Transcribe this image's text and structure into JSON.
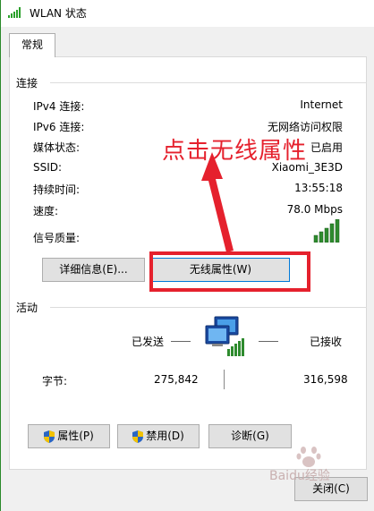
{
  "window": {
    "title": "WLAN 状态"
  },
  "tabs": [
    {
      "label": "常规"
    }
  ],
  "connection": {
    "group_label": "连接",
    "rows": [
      {
        "label": "IPv4 连接:",
        "value": "Internet"
      },
      {
        "label": "IPv6 连接:",
        "value": "无网络访问权限"
      },
      {
        "label": "媒体状态:",
        "value": "已启用"
      },
      {
        "label": "SSID:",
        "value": "Xiaomi_3E3D"
      },
      {
        "label": "持续时间:",
        "value": "13:55:18"
      },
      {
        "label": "速度:",
        "value": "78.0 Mbps"
      }
    ],
    "signal_label": "信号质量:",
    "signal_bars": 5,
    "details_button": "详细信息(E)...",
    "wireless_props_button": "无线属性(W)"
  },
  "activity": {
    "group_label": "活动",
    "sent_label": "已发送",
    "received_label": "已接收",
    "bytes_label": "字节:",
    "bytes_sent": "275,842",
    "bytes_received": "316,598"
  },
  "actions": {
    "properties_button": "属性(P)",
    "disable_button": "禁用(D)",
    "diagnose_button": "诊断(G)"
  },
  "footer": {
    "close_button": "关闭(C)"
  },
  "annotation": {
    "text": "点击无线属性",
    "color": "#e5212d"
  },
  "watermark": {
    "text": "Baidu经验"
  }
}
